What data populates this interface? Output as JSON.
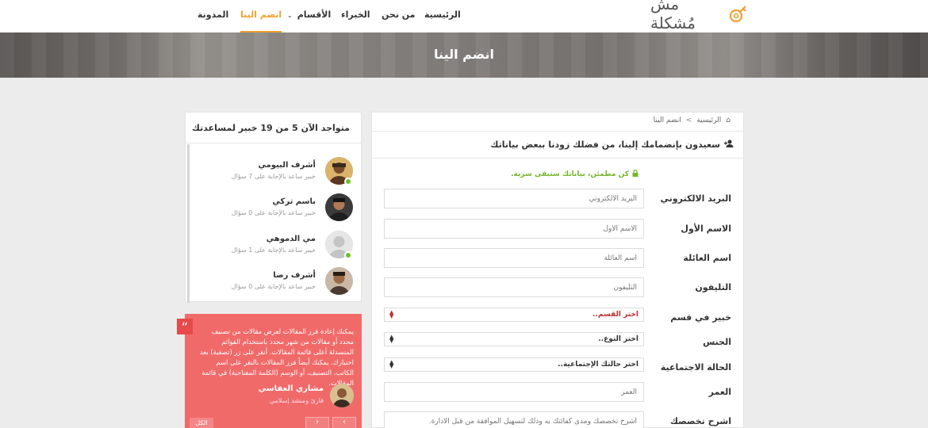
{
  "brand": {
    "name": "مش مُشكلة"
  },
  "nav": {
    "items": [
      {
        "label": "الرئيسية"
      },
      {
        "label": "من نحن"
      },
      {
        "label": "الخبراء"
      },
      {
        "label": "الأقسام"
      },
      {
        "label": "انضم الينا"
      },
      {
        "label": "المدونة"
      }
    ],
    "active": "انضم الينا"
  },
  "banner": {
    "title": "انضم الينا"
  },
  "breadcrumb": {
    "home": "الرئيسية",
    "separator": ">",
    "current": "انضم الينا"
  },
  "form": {
    "heading": "سعيدون بإنضمامك إلينا، من فضلك زودنا ببعض بياناتك",
    "privacy_note": "كن مطمئن، بياناتك ستبقى سرية.",
    "fields": [
      {
        "label": "البريد الالكتروني",
        "placeholder": "البريد الالكتروني"
      },
      {
        "label": "الاسم الأول",
        "placeholder": "الاسم الأول"
      },
      {
        "label": "اسم العائلة",
        "placeholder": "اسم العائلة"
      },
      {
        "label": "التليفون",
        "placeholder": "التليفون"
      },
      {
        "label": "خبير في قسم",
        "selected": "اختر القسم.."
      },
      {
        "label": "الجنس",
        "selected": "اختر النوع.."
      },
      {
        "label": "الحالة الاجتماعية",
        "selected": "اختر حالتك الإجتماعية.."
      },
      {
        "label": "العمر",
        "placeholder": "العمر"
      },
      {
        "label": "اشرح تخصصك",
        "placeholder": "اشرح تخصصك ومدى كفائتك به وذلك لتسهيل الموافقة من قبل الأدارة."
      }
    ]
  },
  "experts": {
    "title": "متواجد الآن 5 من 19 خبير لمساعدتك",
    "list": [
      {
        "name": "أشرف البيومي",
        "meta": "خبير ساعد بالإجابة على 7 سؤال",
        "online": true
      },
      {
        "name": "باسم تركي",
        "meta": "خبير ساعد بالإجابة على 0 سؤال",
        "online": false
      },
      {
        "name": "مي الدموهي",
        "meta": "خبير ساعد بالإجابة على 1 سؤال",
        "online": true
      },
      {
        "name": "أشرف رضا",
        "meta": "خبير ساعد بالإجابة على 0 سؤال",
        "online": false
      }
    ]
  },
  "testimonial": {
    "text": "يمكنك إعادة فرز المقالات لعرض مقالات من تصنيف محدد أو مقالات من شهر محدد باستخدام القوائم المنسدلة أعلى قائمة المقالات. أنقر على زر (تصفية) بعد اختيارك. يمكنك أيضاً فرز المقالات بالنقر على اسم الكاتب، التصنيف، أو الوسم (الكلمة المفتاحية) في قائمة المقالات.",
    "author": "مشاري العفاسي",
    "role": "قارئ ومنشد إسلامي",
    "all_label": "الكل"
  },
  "colors": {
    "accent": "#f0a030",
    "success": "#6cbf2f",
    "testimonial_bg": "#f16a6a",
    "error": "#c03030"
  }
}
